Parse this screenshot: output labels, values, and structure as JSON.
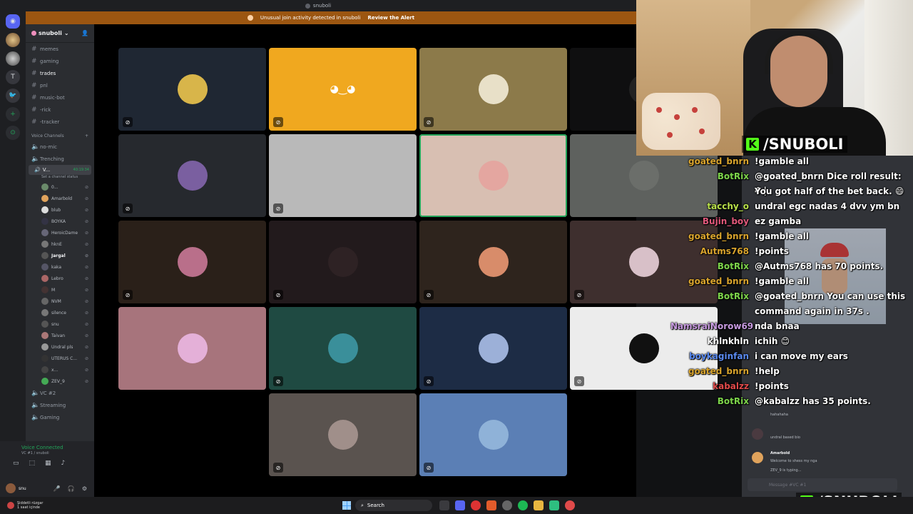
{
  "window": {
    "title": "snuboli"
  },
  "alert": {
    "text": "Unusual join activity detected in snuboli",
    "action": "Review the Alert"
  },
  "server": {
    "name": "snuboli"
  },
  "channels": [
    {
      "name": "memes",
      "bright": false
    },
    {
      "name": "gaming",
      "bright": false
    },
    {
      "name": "trades",
      "bright": true
    },
    {
      "name": "pnl",
      "bright": false
    },
    {
      "name": "music-bot",
      "bright": false
    },
    {
      "name": "-rick",
      "bright": false
    },
    {
      "name": "-tracker",
      "bright": false
    }
  ],
  "voice_category": "Voice Channels",
  "voice_channels_top": [
    "no-mic",
    "Trenching"
  ],
  "active_vc": {
    "name": "V...",
    "timer": "40:19:34",
    "status": "Set a channel status"
  },
  "members": [
    {
      "name": "0...",
      "color": "#6a8a6a",
      "bold": false
    },
    {
      "name": "Amarbold",
      "color": "#e0a35c",
      "bold": false
    },
    {
      "name": "blub",
      "color": "#ddd",
      "bold": false
    },
    {
      "name": "BOYKA",
      "color": "#334",
      "bold": false
    },
    {
      "name": "HeroicDame",
      "color": "#667",
      "bold": false
    },
    {
      "name": "hknE",
      "color": "#777",
      "bold": false
    },
    {
      "name": "Jargal",
      "color": "#555",
      "bold": true
    },
    {
      "name": "kaka",
      "color": "#556",
      "bold": false
    },
    {
      "name": "Lebro",
      "color": "#a66",
      "bold": false
    },
    {
      "name": "M",
      "color": "#433",
      "bold": false
    },
    {
      "name": "NVM",
      "color": "#666",
      "bold": false
    },
    {
      "name": "silence",
      "color": "#777",
      "bold": false
    },
    {
      "name": "snu",
      "color": "#555",
      "bold": false
    },
    {
      "name": "Taivan",
      "color": "#a77",
      "bold": false
    },
    {
      "name": "Undral pls",
      "color": "#999",
      "bold": false
    },
    {
      "name": "UTERUS C...",
      "color": "#333",
      "bold": false
    },
    {
      "name": "x...",
      "color": "#444",
      "bold": false
    },
    {
      "name": "ZEV_9",
      "color": "#4a5",
      "bold": false
    }
  ],
  "voice_channels_bottom": [
    "VC #2",
    "Streaming",
    "Gaming"
  ],
  "voice_panel": {
    "status": "Voice Connected",
    "sub": "VC #1 / snuboli"
  },
  "user_panel": {
    "name": "snu"
  },
  "tiles": [
    {
      "bg": "#1f2733",
      "avatar_bg": "#d8b54a",
      "glyph": "",
      "speaking": false,
      "muted": true
    },
    {
      "bg": "#f0a81f",
      "avatar_bg": "transparent",
      "glyph": "🎮",
      "speaking": false,
      "muted": true
    },
    {
      "bg": "#8c7a4a",
      "avatar_bg": "#e8e0c8",
      "glyph": "",
      "speaking": false,
      "muted": true
    },
    {
      "bg": "#0f0f10",
      "avatar_bg": "#222",
      "glyph": "",
      "speaking": false,
      "muted": false
    },
    {
      "bg": "#26292e",
      "avatar_bg": "#7a5fa0",
      "glyph": "",
      "speaking": false,
      "muted": true
    },
    {
      "bg": "#b9b9b9",
      "avatar_bg": "transparent",
      "glyph": "",
      "speaking": false,
      "muted": true
    },
    {
      "bg": "#d8bfb2",
      "avatar_bg": "#e4a6a0",
      "glyph": "",
      "speaking": true,
      "muted": false
    },
    {
      "bg": "#5e615e",
      "avatar_bg": "#6b6e6a",
      "glyph": "",
      "speaking": false,
      "muted": false
    },
    {
      "bg": "#2a2019",
      "avatar_bg": "#b96f8a",
      "glyph": "",
      "speaking": false,
      "muted": true
    },
    {
      "bg": "#221a1c",
      "avatar_bg": "#2e2224",
      "glyph": "",
      "speaking": false,
      "muted": true
    },
    {
      "bg": "#2e241d",
      "avatar_bg": "#d88c6a",
      "glyph": "",
      "speaking": false,
      "muted": true
    },
    {
      "bg": "#3e2f2e",
      "avatar_bg": "#d8c0c8",
      "glyph": "",
      "speaking": false,
      "muted": true
    },
    {
      "bg": "#a7747c",
      "avatar_bg": "#e4b0d8",
      "glyph": "",
      "speaking": false,
      "muted": false
    },
    {
      "bg": "#1f4a42",
      "avatar_bg": "#3a8f9a",
      "glyph": "",
      "speaking": false,
      "muted": true
    },
    {
      "bg": "#1d2c45",
      "avatar_bg": "#9cb0d8",
      "glyph": "",
      "speaking": false,
      "muted": true
    },
    {
      "bg": "#ececec",
      "avatar_bg": "#111",
      "glyph": "",
      "speaking": false,
      "muted": true
    },
    {
      "bg": "#5a534f",
      "avatar_bg": "#a08f8a",
      "glyph": "",
      "speaking": false,
      "muted": true
    },
    {
      "bg": "#5b7fb5",
      "avatar_bg": "#8fb2d8",
      "glyph": "",
      "speaking": false,
      "muted": true
    }
  ],
  "brand": {
    "text": "/SNUBOLI",
    "k": "K"
  },
  "chat": [
    {
      "user": "goated_bnrn",
      "color": "#d9a42d",
      "text": "!gamble all"
    },
    {
      "user": "BotRix",
      "color": "#7cd34a",
      "text": "@goated_bnrn Dice roll result: 4 |"
    },
    {
      "user": "",
      "color": "#ffffff",
      "text": "You got half of the bet back. 😄"
    },
    {
      "user": "tacchy_o",
      "color": "#b8e04a",
      "text": "undral egc nadas 4 dvv ym bn"
    },
    {
      "user": "Bujin_boy",
      "color": "#e0587a",
      "text": "ez gamba"
    },
    {
      "user": "goated_bnrn",
      "color": "#d9a42d",
      "text": "!gamble all"
    },
    {
      "user": "Autms768",
      "color": "#d9a42d",
      "text": "!points"
    },
    {
      "user": "BotRix",
      "color": "#7cd34a",
      "text": "@Autms768 has 70 points."
    },
    {
      "user": "goated_bnrn",
      "color": "#d9a42d",
      "text": "!gamble all"
    },
    {
      "user": "BotRix",
      "color": "#7cd34a",
      "text": "@goated_bnrn You can use this"
    },
    {
      "user": "",
      "color": "#ffffff",
      "text": "command again in 37s ."
    },
    {
      "user": "NamsraiNorow69",
      "color": "#c79ae0",
      "text": "nda bnaa"
    },
    {
      "user": "khlnkhln",
      "color": "#ffffff",
      "text": "ichih 😊"
    },
    {
      "user": "boykaginfan",
      "color": "#5a8af0",
      "text": "i can move my ears"
    },
    {
      "user": "goated_bnrn",
      "color": "#d9a42d",
      "text": "!help"
    },
    {
      "user": "kabalzz",
      "color": "#e04a4a",
      "text": "!points"
    },
    {
      "user": "BotRix",
      "color": "#7cd34a",
      "text": "@kabalzz has 35 points."
    }
  ],
  "discord_chat": [
    {
      "text": "hahahaha"
    },
    {
      "text": "undral based bio"
    },
    {
      "user": "Amarbold",
      "text": "Welcome to shess my nga"
    },
    {
      "text": "ZEV_9 is typing..."
    }
  ],
  "message_placeholder": "Message #VC #1",
  "taskbar": {
    "weather": "Şiddetli rüzgar",
    "weather_sub": "1 saat içinde",
    "search": "Search"
  }
}
